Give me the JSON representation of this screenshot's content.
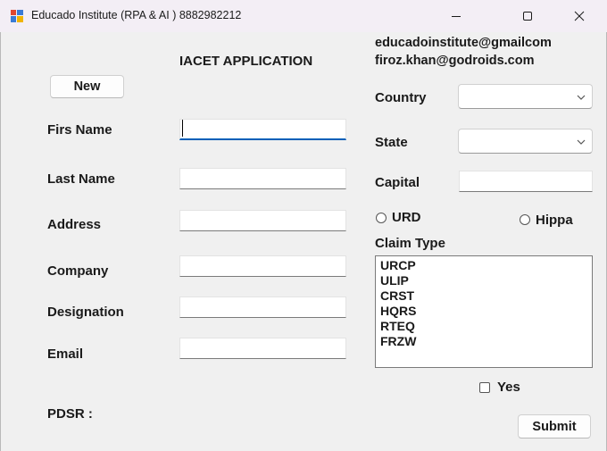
{
  "window": {
    "title": "Educado Institute (RPA & AI ) 8882982212"
  },
  "form": {
    "heading": "IACET APPLICATION",
    "new_button": "New",
    "contact_email_1": "educadoinstitute@gmailcom",
    "contact_email_2": "firoz.khan@godroids.com",
    "first_name_label": "Firs Name",
    "last_name_label": "Last Name",
    "address_label": "Address",
    "company_label": "Company",
    "designation_label": "Designation",
    "email_label": "Email",
    "pdsr_label": "PDSR :",
    "first_name_value": "",
    "last_name_value": "",
    "address_value": "",
    "company_value": "",
    "designation_value": "",
    "email_value": "",
    "country_label": "Country",
    "country_value": "",
    "state_label": "State",
    "state_value": "",
    "capital_label": "Capital",
    "capital_value": "",
    "urd_label": "URD",
    "hippa_label": "Hippa",
    "claim_type_label": "Claim Type",
    "claim_types": [
      "URCP",
      "ULIP",
      "CRST",
      "HQRS",
      "RTEQ",
      "FRZW"
    ],
    "yes_label": "Yes",
    "submit_button": "Submit"
  }
}
